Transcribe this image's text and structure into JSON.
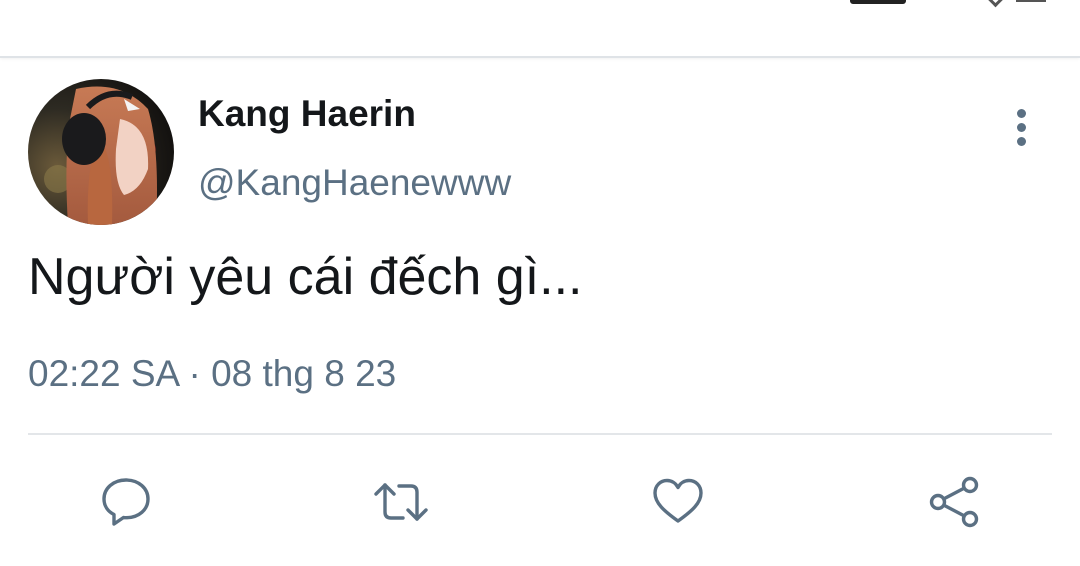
{
  "tweet": {
    "author": {
      "name": "Kang Haerin",
      "handle": "@KangHaenewww",
      "avatar": "profile-photo"
    },
    "text": "Người yêu cái đếch gì...",
    "meta": {
      "time": "02:22 SA",
      "separator": "·",
      "date": "08 thg 8 23"
    }
  },
  "actions": [
    {
      "icon": "reply-icon"
    },
    {
      "icon": "retweet-icon"
    },
    {
      "icon": "like-icon"
    },
    {
      "icon": "share-icon"
    }
  ],
  "colors": {
    "text_primary": "#14171a",
    "text_secondary": "#5b7083",
    "divider": "#e3e6e9",
    "background": "#ffffff"
  }
}
